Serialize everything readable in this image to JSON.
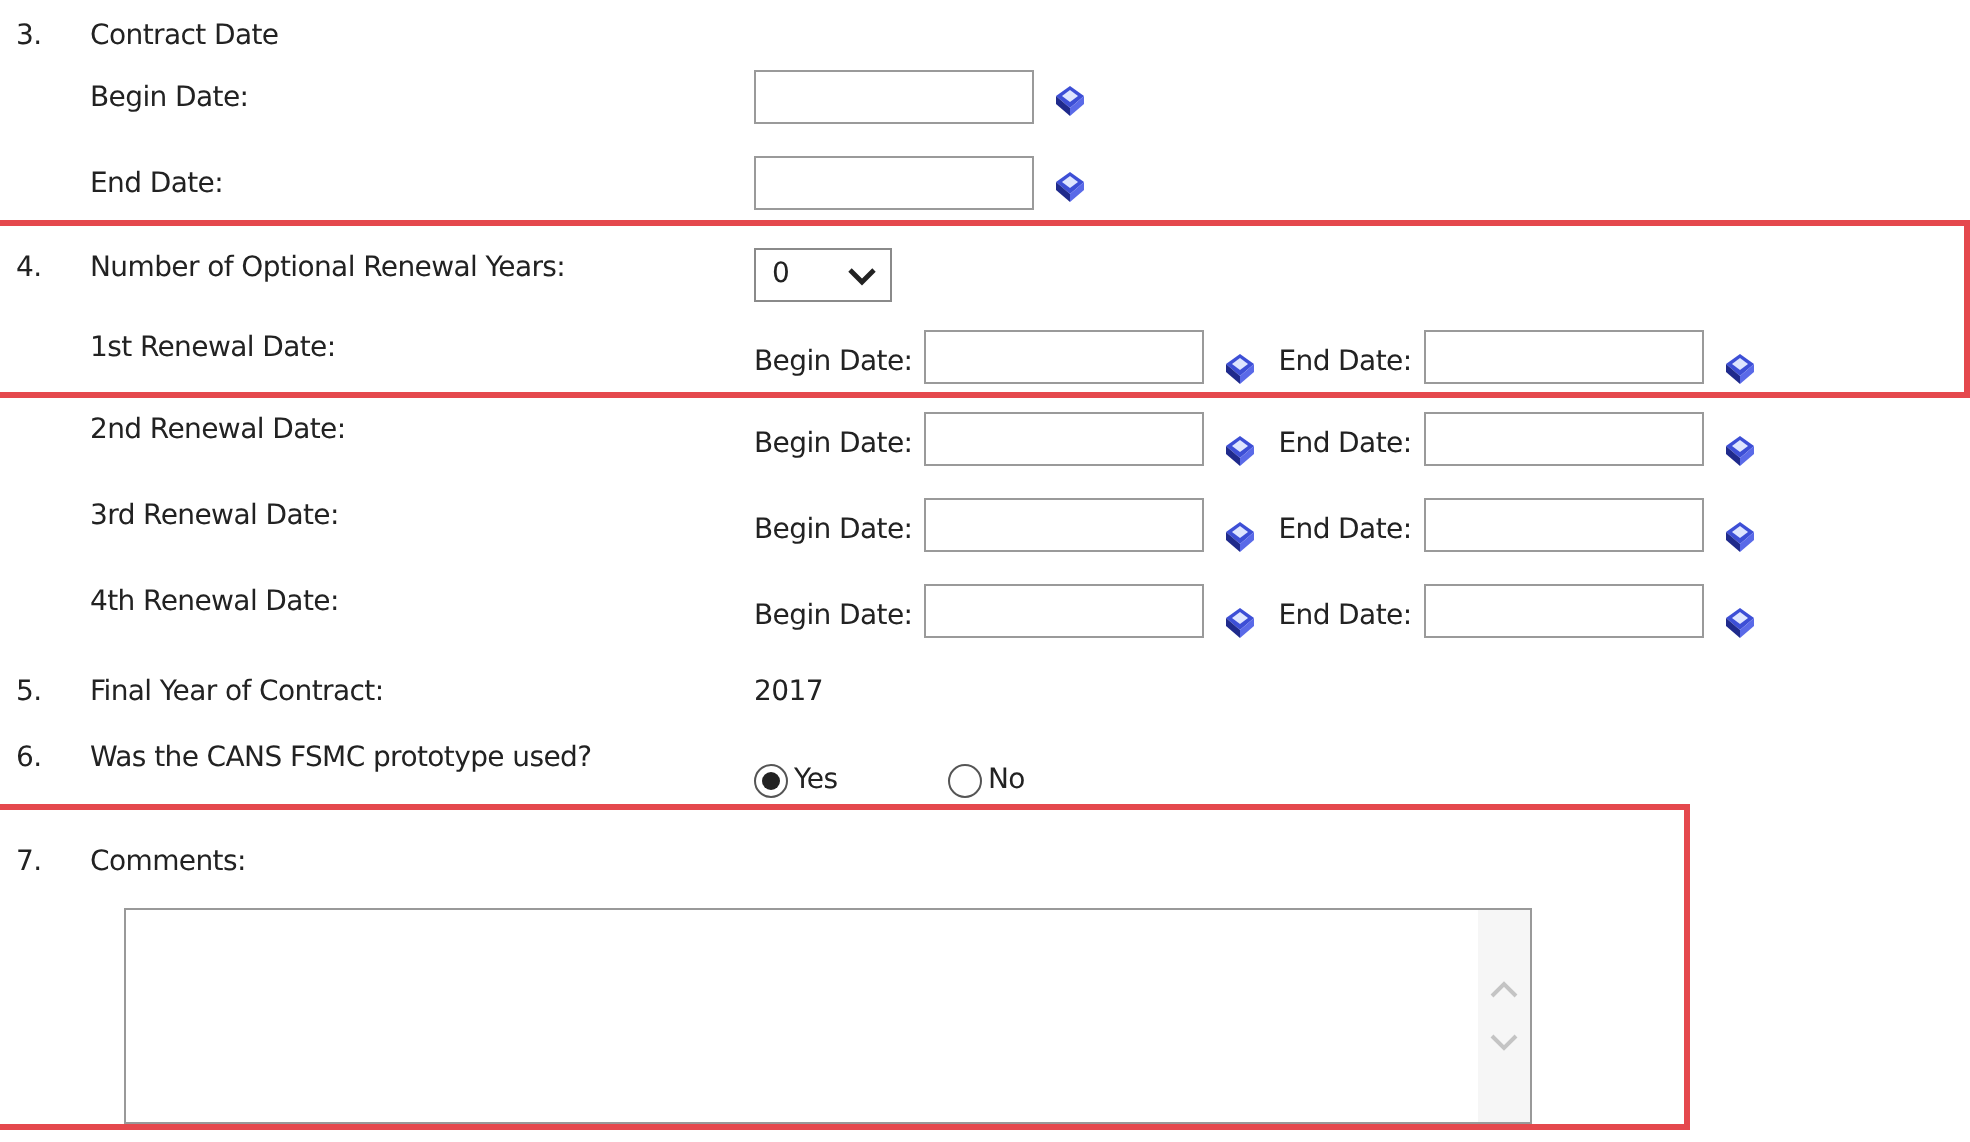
{
  "groups": [
    {
      "highlighted": false,
      "rows": [
        {
          "kind": "heading",
          "number": "3.",
          "label": "Contract Date"
        },
        {
          "kind": "date",
          "label": "Begin Date:"
        },
        {
          "kind": "date",
          "label": "End Date:"
        }
      ]
    },
    {
      "highlighted": true,
      "rows": [
        {
          "kind": "select",
          "number": "4.",
          "label": "Number of Optional Renewal Years:",
          "value": "0"
        },
        {
          "kind": "range",
          "label": "1st Renewal Date:",
          "begin_label": "Begin Date:",
          "end_label": "End Date:"
        }
      ]
    },
    {
      "highlighted": false,
      "rows": [
        {
          "kind": "range",
          "label": "2nd Renewal Date:",
          "begin_label": "Begin Date:",
          "end_label": "End Date:"
        },
        {
          "kind": "range",
          "label": "3rd Renewal Date:",
          "begin_label": "Begin Date:",
          "end_label": "End Date:"
        },
        {
          "kind": "range",
          "label": "4th Renewal Date:",
          "begin_label": "Begin Date:",
          "end_label": "End Date:"
        },
        {
          "kind": "value",
          "number": "5.",
          "label": "Final Year of Contract:",
          "value": "2017"
        },
        {
          "kind": "radio",
          "number": "6.",
          "label": "Was the CANS FSMC prototype used?",
          "options": [
            {
              "label": "Yes",
              "selected": true
            },
            {
              "label": "No",
              "selected": false
            }
          ]
        }
      ]
    },
    {
      "highlighted": true,
      "rows": [
        {
          "kind": "textarea",
          "number": "7.",
          "label": "Comments:"
        }
      ]
    }
  ]
}
